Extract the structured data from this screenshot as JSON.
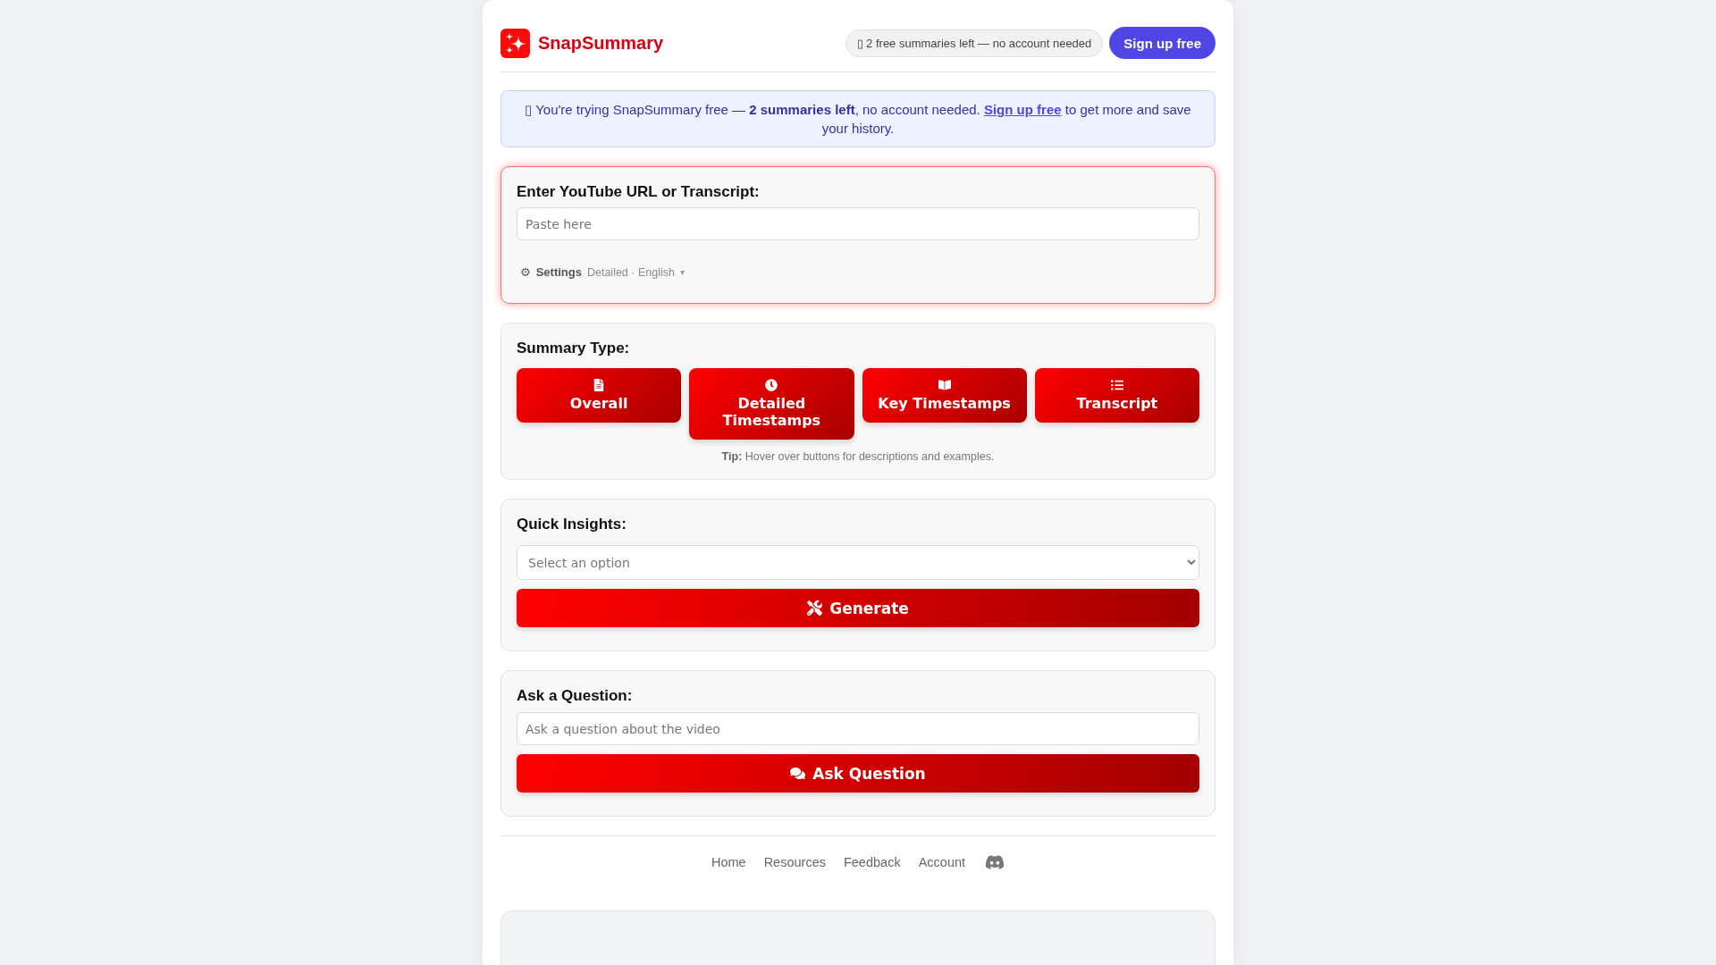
{
  "header": {
    "logo": "SnapSummary",
    "badge": "▯ 2 free summaries left — no account needed",
    "signup_button": "Sign up free"
  },
  "notice": {
    "before_link": "▯ You're trying SnapSummary free — **2 summaries left**, no account needed.",
    "link": "Sign up free",
    "after_link": "to get more and save your history."
  },
  "source_card": {
    "label": "Enter YouTube URL or Transcript:",
    "input": {
      "placeholder": "Paste here"
    },
    "settings": {
      "icon": "⚙",
      "label": "Settings",
      "value": "Detailed · English",
      "caret": "▾"
    }
  },
  "summary_type": {
    "label": "Summary Type:",
    "buttons": [
      "Overall",
      "Detailed Timestamps",
      "Key Timestamps",
      "Transcript"
    ],
    "tip": "**Tip:** Hover over buttons for descriptions and examples."
  },
  "quick_insights": {
    "label": "Quick Insights:",
    "select": {
      "placeholder": "Select an option"
    },
    "button": "Generate"
  },
  "ask": {
    "label": "Ask a Question:",
    "input": {
      "placeholder": "Ask a question about the video"
    },
    "button": "Ask Question"
  },
  "footer": {
    "links": [
      "Home",
      "Resources",
      "Feedback",
      "Account"
    ]
  }
}
